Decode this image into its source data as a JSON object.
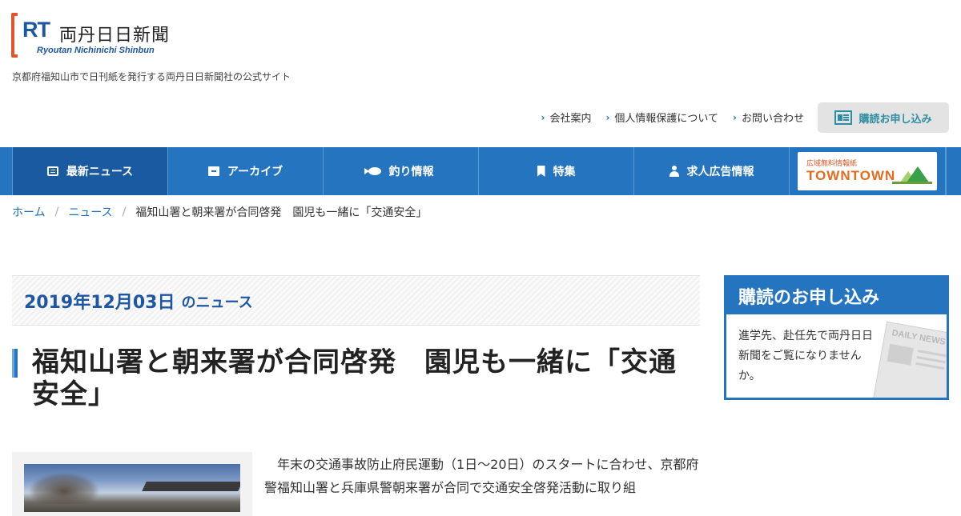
{
  "header": {
    "logo_mark": "RT",
    "logo_jp": "両丹日日新聞",
    "logo_en": "Ryoutan Nichinichi Shinbun",
    "tagline": "京都府福知山市で日刊紙を発行する両丹日日新聞社の公式サイト",
    "util_links": [
      {
        "label": "会社案内"
      },
      {
        "label": "個人情報保護について"
      },
      {
        "label": "お問い合わせ"
      }
    ],
    "subscribe_label": "購読お申し込み"
  },
  "nav": {
    "items": [
      {
        "label": "最新ニュース",
        "icon": "newspaper-icon"
      },
      {
        "label": "アーカイブ",
        "icon": "archive-icon"
      },
      {
        "label": "釣り情報",
        "icon": "fish-icon"
      },
      {
        "label": "特集",
        "icon": "bookmark-icon"
      },
      {
        "label": "求人広告情報",
        "icon": "user-icon"
      }
    ],
    "banner_small": "広域無料情報紙",
    "banner_big": "TOWNTOWN"
  },
  "breadcrumb": {
    "home": "ホーム",
    "section": "ニュース",
    "separator": "/",
    "current": "福知山署と朝来署が合同啓発　園児も一緒に「交通安全」"
  },
  "article": {
    "date": "2019年12月03日",
    "date_suffix": "のニュース",
    "title": "福知山署と朝来署が合同啓発　園児も一緒に「交通安全」",
    "body": "年末の交通事故防止府民運動（1日～20日）のスタートに合わせ、京都府警福知山署と兵庫県警朝来署が合同で交通安全啓発活動に取り組"
  },
  "sidebar": {
    "title": "購読のお申し込み",
    "text": "進学先、赴任先で両丹日日新聞をご覧になりませんか。",
    "paper_title": "DAILY NEWS"
  },
  "colors": {
    "primary": "#2474bf",
    "primary_dark": "#1a5aa0",
    "accent": "#e2542b",
    "link": "#1d6fb8"
  }
}
